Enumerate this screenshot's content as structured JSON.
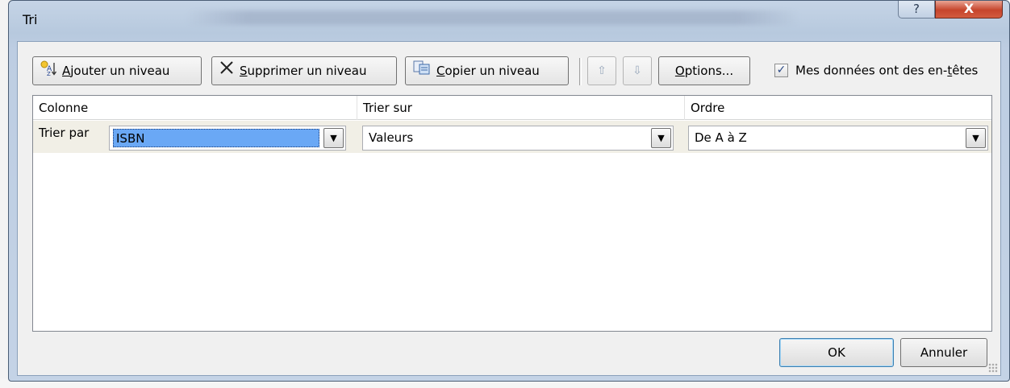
{
  "dialog": {
    "title": "Tri",
    "help_glyph": "?",
    "close_glyph": "X"
  },
  "toolbar": {
    "add_level": {
      "prefix": "",
      "mnemonic": "A",
      "rest": "jouter un niveau",
      "icon": "add-level-icon"
    },
    "delete_level": {
      "mnemonic": "S",
      "rest": "upprimer un niveau",
      "icon": "delete-x-icon"
    },
    "copy_level": {
      "mnemonic": "C",
      "rest": "opier un niveau",
      "icon": "copy-icon"
    },
    "move_up_glyph": "⇧",
    "move_down_glyph": "⇩",
    "options": {
      "mnemonic": "O",
      "rest": "ptions..."
    },
    "headers_checkbox": {
      "checked": true,
      "glyph": "✓",
      "label_before": "Mes données ont des en-",
      "mnemonic": "t",
      "label_after": "êtes"
    }
  },
  "grid": {
    "columns": [
      "Colonne",
      "Trier sur",
      "Ordre"
    ],
    "rows": [
      {
        "label": "Trier par",
        "column": "ISBN",
        "sort_on": "Valeurs",
        "order": "De A à Z"
      }
    ],
    "dropdown_glyph": "▼"
  },
  "footer": {
    "ok": "OK",
    "cancel": "Annuler"
  },
  "colors": {
    "selection": "#6aa8f5",
    "row_bg": "#f1efe6",
    "close": "#c6452c"
  }
}
